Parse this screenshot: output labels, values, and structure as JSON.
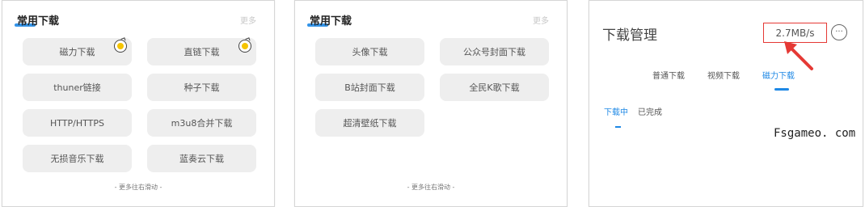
{
  "panel1": {
    "header": "常用下载",
    "more": "更多",
    "buttons": [
      {
        "label": "磁力下载"
      },
      {
        "label": "直链下载"
      },
      {
        "label": "thuner链接"
      },
      {
        "label": "种子下载"
      },
      {
        "label": "HTTP/HTTPS"
      },
      {
        "label": "m3u8合并下载"
      },
      {
        "label": "无损音乐下载"
      },
      {
        "label": "蓝奏云下载"
      }
    ],
    "footer": "- 更多往右滑动 -"
  },
  "panel2": {
    "header": "常用下载",
    "more": "更多",
    "buttons": [
      {
        "label": "头像下载"
      },
      {
        "label": "公众号封面下载"
      },
      {
        "label": "B站封面下载"
      },
      {
        "label": "全民K歌下载"
      },
      {
        "label": "超清壁纸下载"
      }
    ],
    "footer": "- 更多往右滑动 -"
  },
  "panel3": {
    "title": "下载管理",
    "speed": "2.7MB/s",
    "menu_glyph": "···",
    "tabs": [
      "普通下载",
      "视频下载",
      "磁力下载"
    ],
    "active_tab": "磁力下载",
    "subtabs": [
      "下载中",
      "已完成"
    ],
    "active_subtab": "下载中",
    "watermark": "Fsgameo. com"
  },
  "colors": {
    "accent": "#1e88e5",
    "highlight_box": "#e53935",
    "badge": "#f5c400",
    "button_bg": "#eeeeee"
  },
  "icons": {
    "badge": "coin-badge-icon",
    "menu": "more-options-icon",
    "annotation": "red-arrow-icon"
  }
}
